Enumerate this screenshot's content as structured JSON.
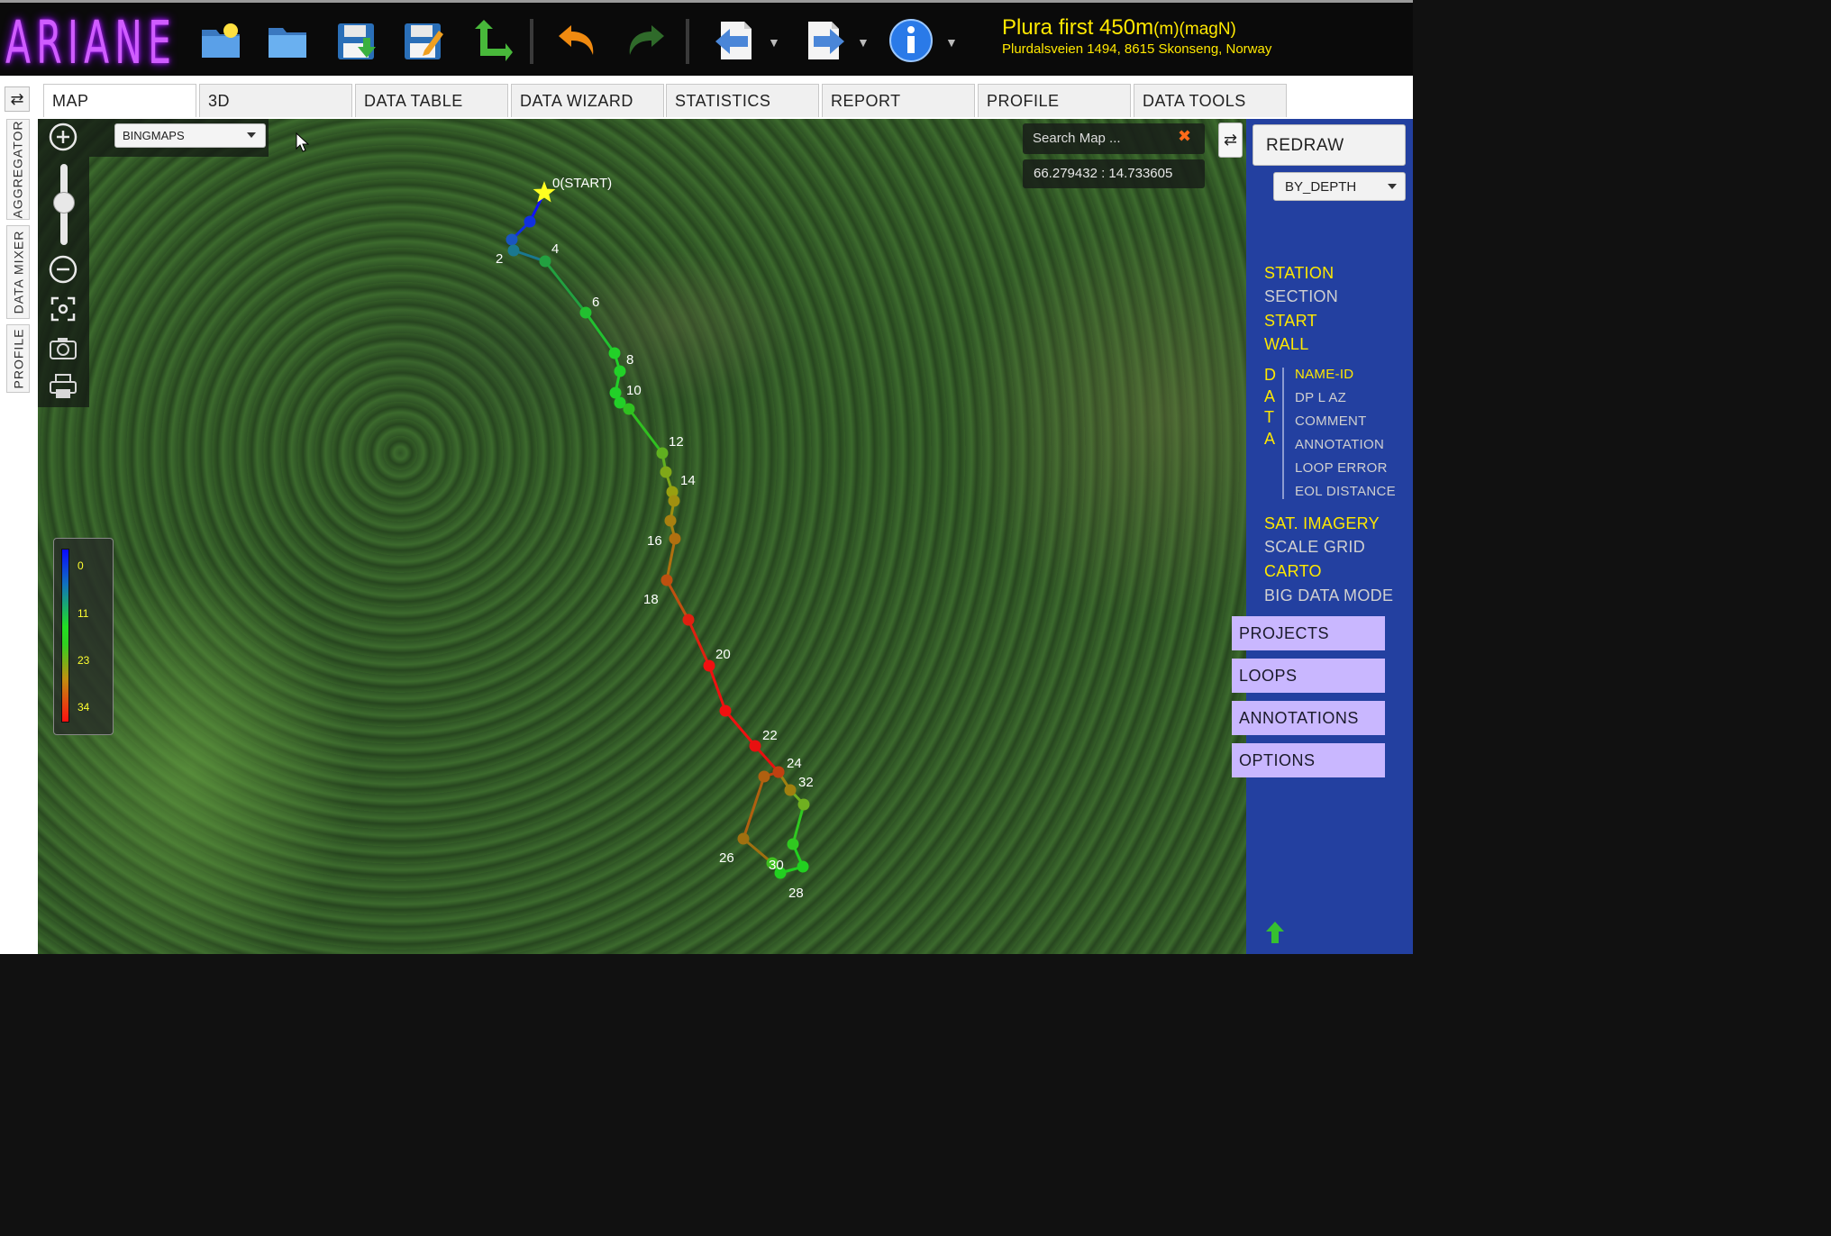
{
  "app": {
    "logo": "ARIANE",
    "project_title": "Plura first 450m",
    "project_unit": "(m)(magN)",
    "project_address": "Plurdalsveien 1494, 8615 Skonseng, Norway"
  },
  "toolbar": {
    "icons": [
      "new-project-icon",
      "open-folder-icon",
      "save-icon",
      "save-as-icon",
      "add-station-icon",
      "undo-icon",
      "redo-icon",
      "import-icon",
      "export-icon",
      "info-icon"
    ]
  },
  "tabs": [
    "MAP",
    "3D",
    "DATA TABLE",
    "DATA WIZARD",
    "STATISTICS",
    "REPORT",
    "PROFILE",
    "DATA TOOLS"
  ],
  "vertical_tabs": [
    "AGGREGATOR",
    "DATA MIXER",
    "PROFILE"
  ],
  "map": {
    "basemap": "BINGMAPS",
    "search_placeholder": "Search Map ...",
    "coordinates": "66.279432 : 14.733605",
    "legend": {
      "labels": [
        "0",
        "11",
        "23",
        "34"
      ]
    },
    "start_label": "0(START)",
    "station_labels": [
      "2",
      "4",
      "6",
      "8",
      "10",
      "12",
      "14",
      "16",
      "18",
      "20",
      "22",
      "24",
      "26",
      "28",
      "30",
      "32"
    ]
  },
  "right_panel": {
    "redraw": "REDRAW",
    "color_mode": "BY_DEPTH",
    "options": [
      {
        "label": "STATION",
        "on": true
      },
      {
        "label": "SECTION",
        "on": false
      },
      {
        "label": "START",
        "on": true
      },
      {
        "label": "WALL",
        "on": true
      }
    ],
    "data_letters": [
      "D",
      "A",
      "T",
      "A"
    ],
    "data_options": [
      {
        "label": "NAME-ID",
        "on": true
      },
      {
        "label": "DP   L   AZ",
        "on": false
      },
      {
        "label": "COMMENT",
        "on": false
      },
      {
        "label": "ANNOTATION",
        "on": false
      },
      {
        "label": "LOOP ERROR",
        "on": false
      },
      {
        "label": "EOL DISTANCE",
        "on": false
      }
    ],
    "options2": [
      {
        "label": "SAT. IMAGERY",
        "on": true
      },
      {
        "label": "SCALE  GRID",
        "on": false
      },
      {
        "label": "CARTO",
        "on": true
      },
      {
        "label": "BIG DATA MODE",
        "on": false
      }
    ],
    "buttons": [
      "PROJECTS",
      "LOOPS",
      "ANNOTATIONS",
      "OPTIONS"
    ]
  }
}
